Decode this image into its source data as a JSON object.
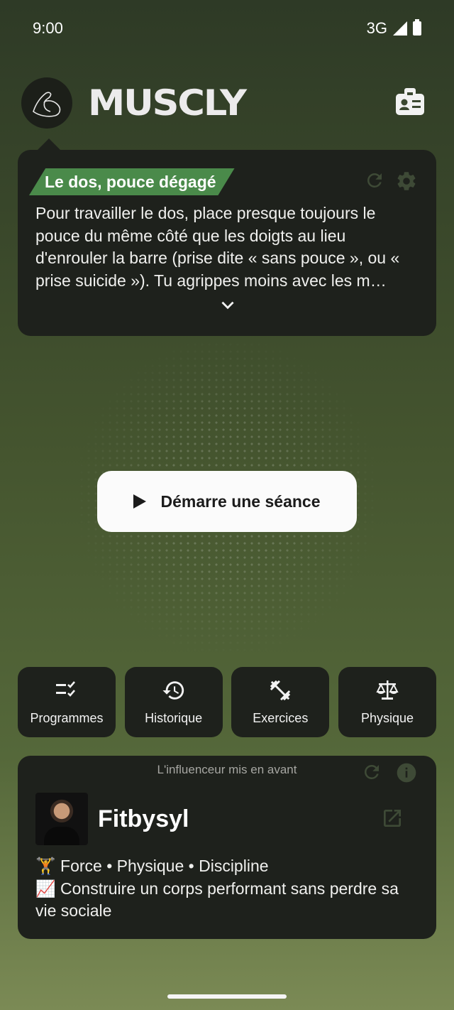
{
  "status_bar": {
    "time": "9:00",
    "network": "3G"
  },
  "header": {
    "brand": "MUSCLY",
    "logo_icon": "flexed-arm-icon",
    "profile_icon": "id-badge-icon"
  },
  "tip": {
    "tag": "Le dos, pouce dégagé",
    "text": "Pour travailler le dos, place presque toujours le pouce du même côté que les doigts au lieu d'enrouler la barre (prise dite « sans pouce », ou « prise suicide »). Tu agrippes moins avec les m…",
    "refresh_icon": "refresh-icon",
    "settings_icon": "gear-icon",
    "expand_icon": "chevron-down-icon"
  },
  "start_button": {
    "label": "Démarre une séance",
    "icon": "play-icon"
  },
  "nav": [
    {
      "label": "Programmes",
      "icon": "checklist-icon"
    },
    {
      "label": "Historique",
      "icon": "history-icon"
    },
    {
      "label": "Exercices",
      "icon": "dumbbell-icon"
    },
    {
      "label": "Physique",
      "icon": "scale-icon"
    }
  ],
  "influencer": {
    "title": "L'influenceur mis en avant",
    "name": "Fitbysyl",
    "description": "🏋️ Force • Physique • Discipline\n📈 Construire un corps performant sans perdre sa vie sociale",
    "refresh_icon": "refresh-icon",
    "info_icon": "info-icon",
    "open_icon": "external-link-icon"
  },
  "colors": {
    "accent_green": "#4a8a4a",
    "card_bg": "#1e211c"
  }
}
